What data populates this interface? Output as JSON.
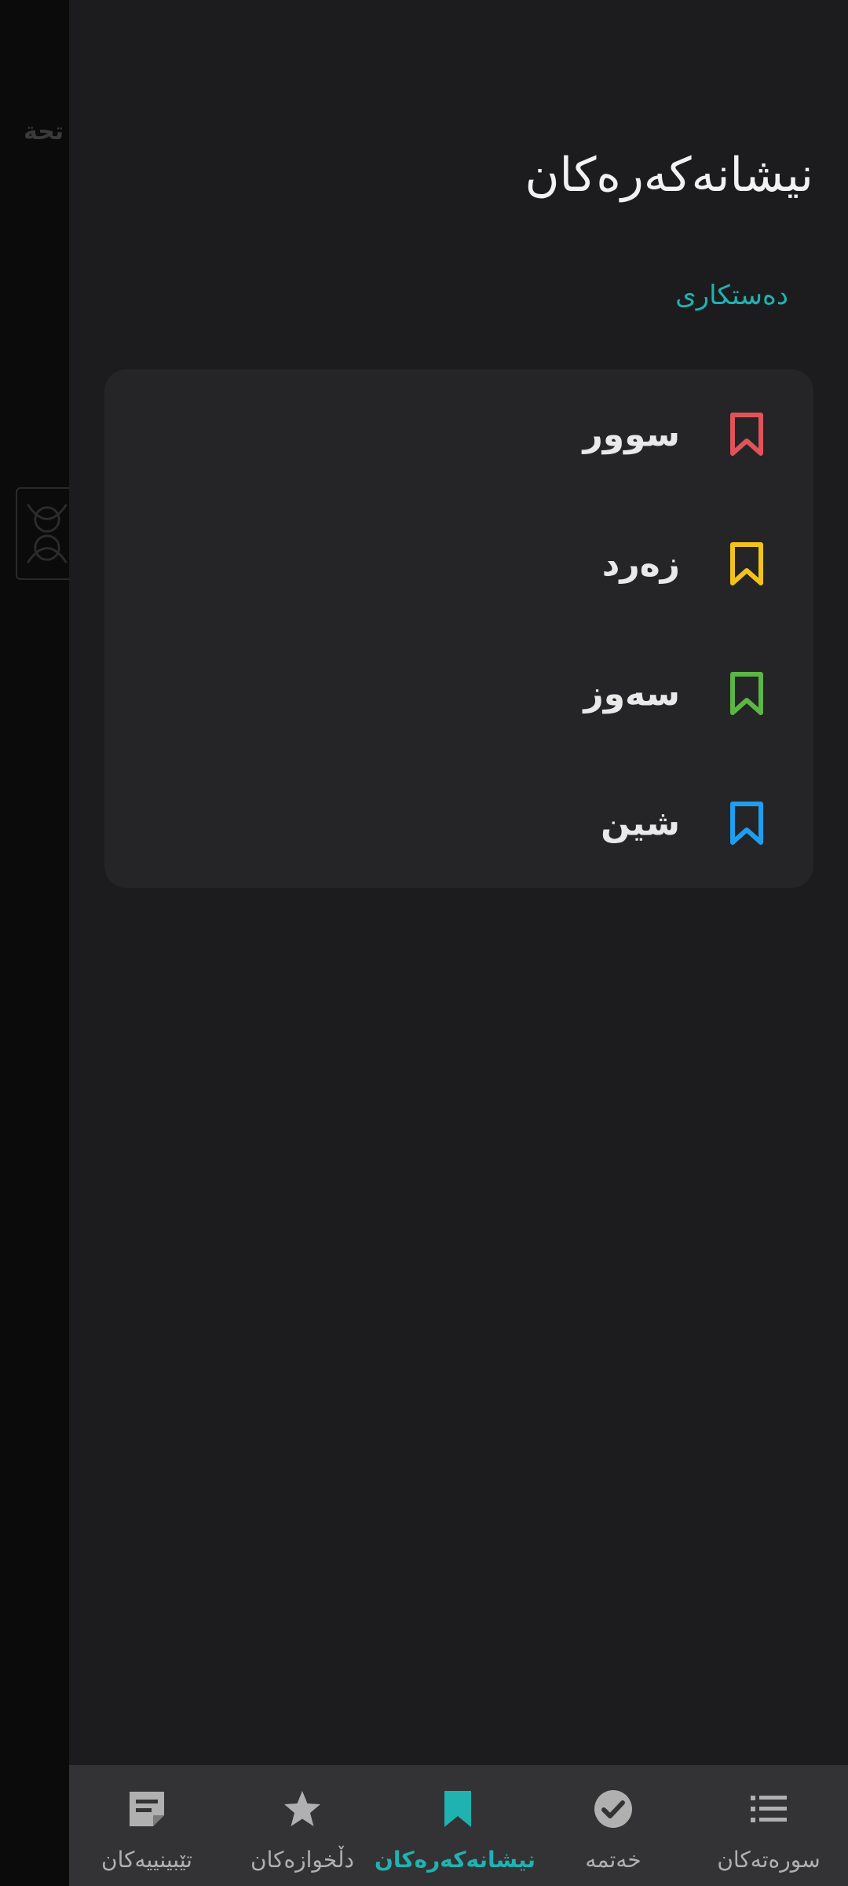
{
  "background": {
    "page_title_fragment": "تحة"
  },
  "drawer": {
    "title": "نیشانەکەرەکان",
    "edit_label": "دەستکاری",
    "bookmarks": [
      {
        "label": "سوور",
        "color": "#e0535a",
        "icon": "bookmark-outline-icon"
      },
      {
        "label": "زەرد",
        "color": "#f2c31a",
        "icon": "bookmark-outline-icon"
      },
      {
        "label": "سەوز",
        "color": "#5cb545",
        "icon": "bookmark-outline-icon"
      },
      {
        "label": "شین",
        "color": "#1f9ef0",
        "icon": "bookmark-outline-icon"
      }
    ]
  },
  "bottom_nav": {
    "accent": "#1fb2b0",
    "items": [
      {
        "label": "تێبینییەکان",
        "icon": "note-icon",
        "active": false
      },
      {
        "label": "دڵخوازەکان",
        "icon": "star-icon",
        "active": false
      },
      {
        "label": "نیشانەکەرەکان",
        "icon": "bookmark-icon",
        "active": true
      },
      {
        "label": "خەتمە",
        "icon": "check-circle-icon",
        "active": false
      },
      {
        "label": "سورەتەکان",
        "icon": "list-icon",
        "active": false
      }
    ]
  }
}
